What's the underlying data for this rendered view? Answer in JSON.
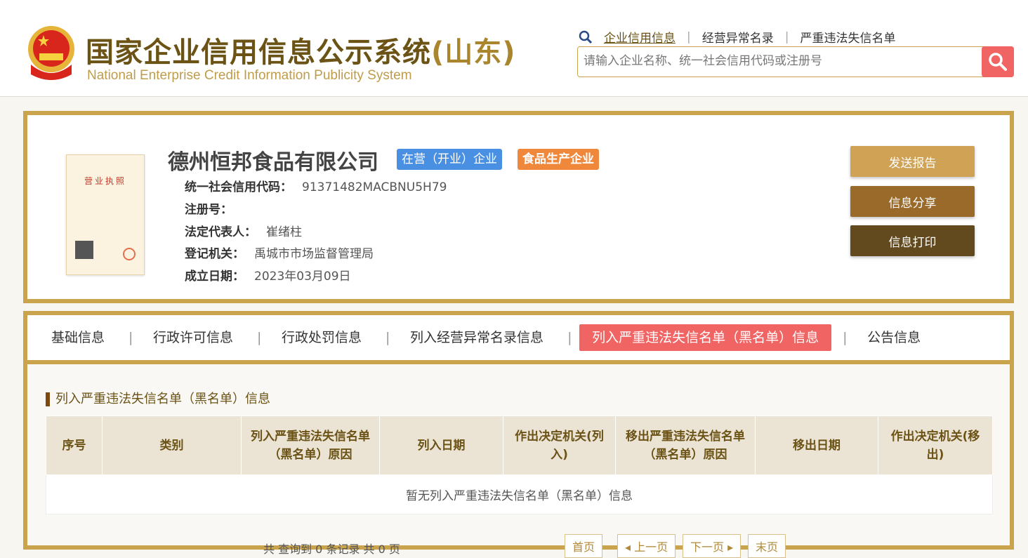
{
  "header": {
    "title_cn": "国家企业信用信息公示系统",
    "title_region": "(山东)",
    "title_en": "National Enterprise Credit Information Publicity System",
    "links": [
      "企业信用信息",
      "经营异常名录",
      "严重违法失信名单"
    ],
    "search_placeholder": "请输入企业名称、统一社会信用代码或注册号"
  },
  "company": {
    "name": "德州恒邦食品有限公司",
    "status_badge": "在营（开业）企业",
    "type_badge": "食品生产企业",
    "license_label": "营业执照",
    "fields": [
      {
        "k": "统一社会信用代码：",
        "v": "91371482MACBNU5H79"
      },
      {
        "k": "注册号：",
        "v": ""
      },
      {
        "k": "法定代表人：",
        "v": "崔绪柱"
      },
      {
        "k": "登记机关：",
        "v": "禹城市市场监督管理局"
      },
      {
        "k": "成立日期：",
        "v": "2023年03月09日"
      }
    ]
  },
  "actions": {
    "send": "发送报告",
    "share": "信息分享",
    "print": "信息打印"
  },
  "colors": {
    "send": "#cfa255",
    "share": "#9a6a2a",
    "print": "#634a1e",
    "accent": "#c9a44d",
    "active_tab": "#f06464"
  },
  "tabs": [
    "基础信息",
    "行政许可信息",
    "行政处罚信息",
    "列入经营异常名录信息",
    "列入严重违法失信名单（黑名单）信息",
    "公告信息"
  ],
  "section": {
    "title": "列入严重违法失信名单（黑名单）信息",
    "columns": [
      "序号",
      "类别",
      "列入严重违法失信名单（黑名单）原因",
      "列入日期",
      "作出决定机关(列入)",
      "移出严重违法失信名单（黑名单）原因",
      "移出日期",
      "作出决定机关(移出)"
    ],
    "empty": "暂无列入严重违法失信名单（黑名单）信息"
  },
  "pager": {
    "count": "共 查询到 0 条记录 共 0 页",
    "first": "首页",
    "prev": "◂ 上一页",
    "next": "下一页 ▸",
    "last": "末页"
  }
}
